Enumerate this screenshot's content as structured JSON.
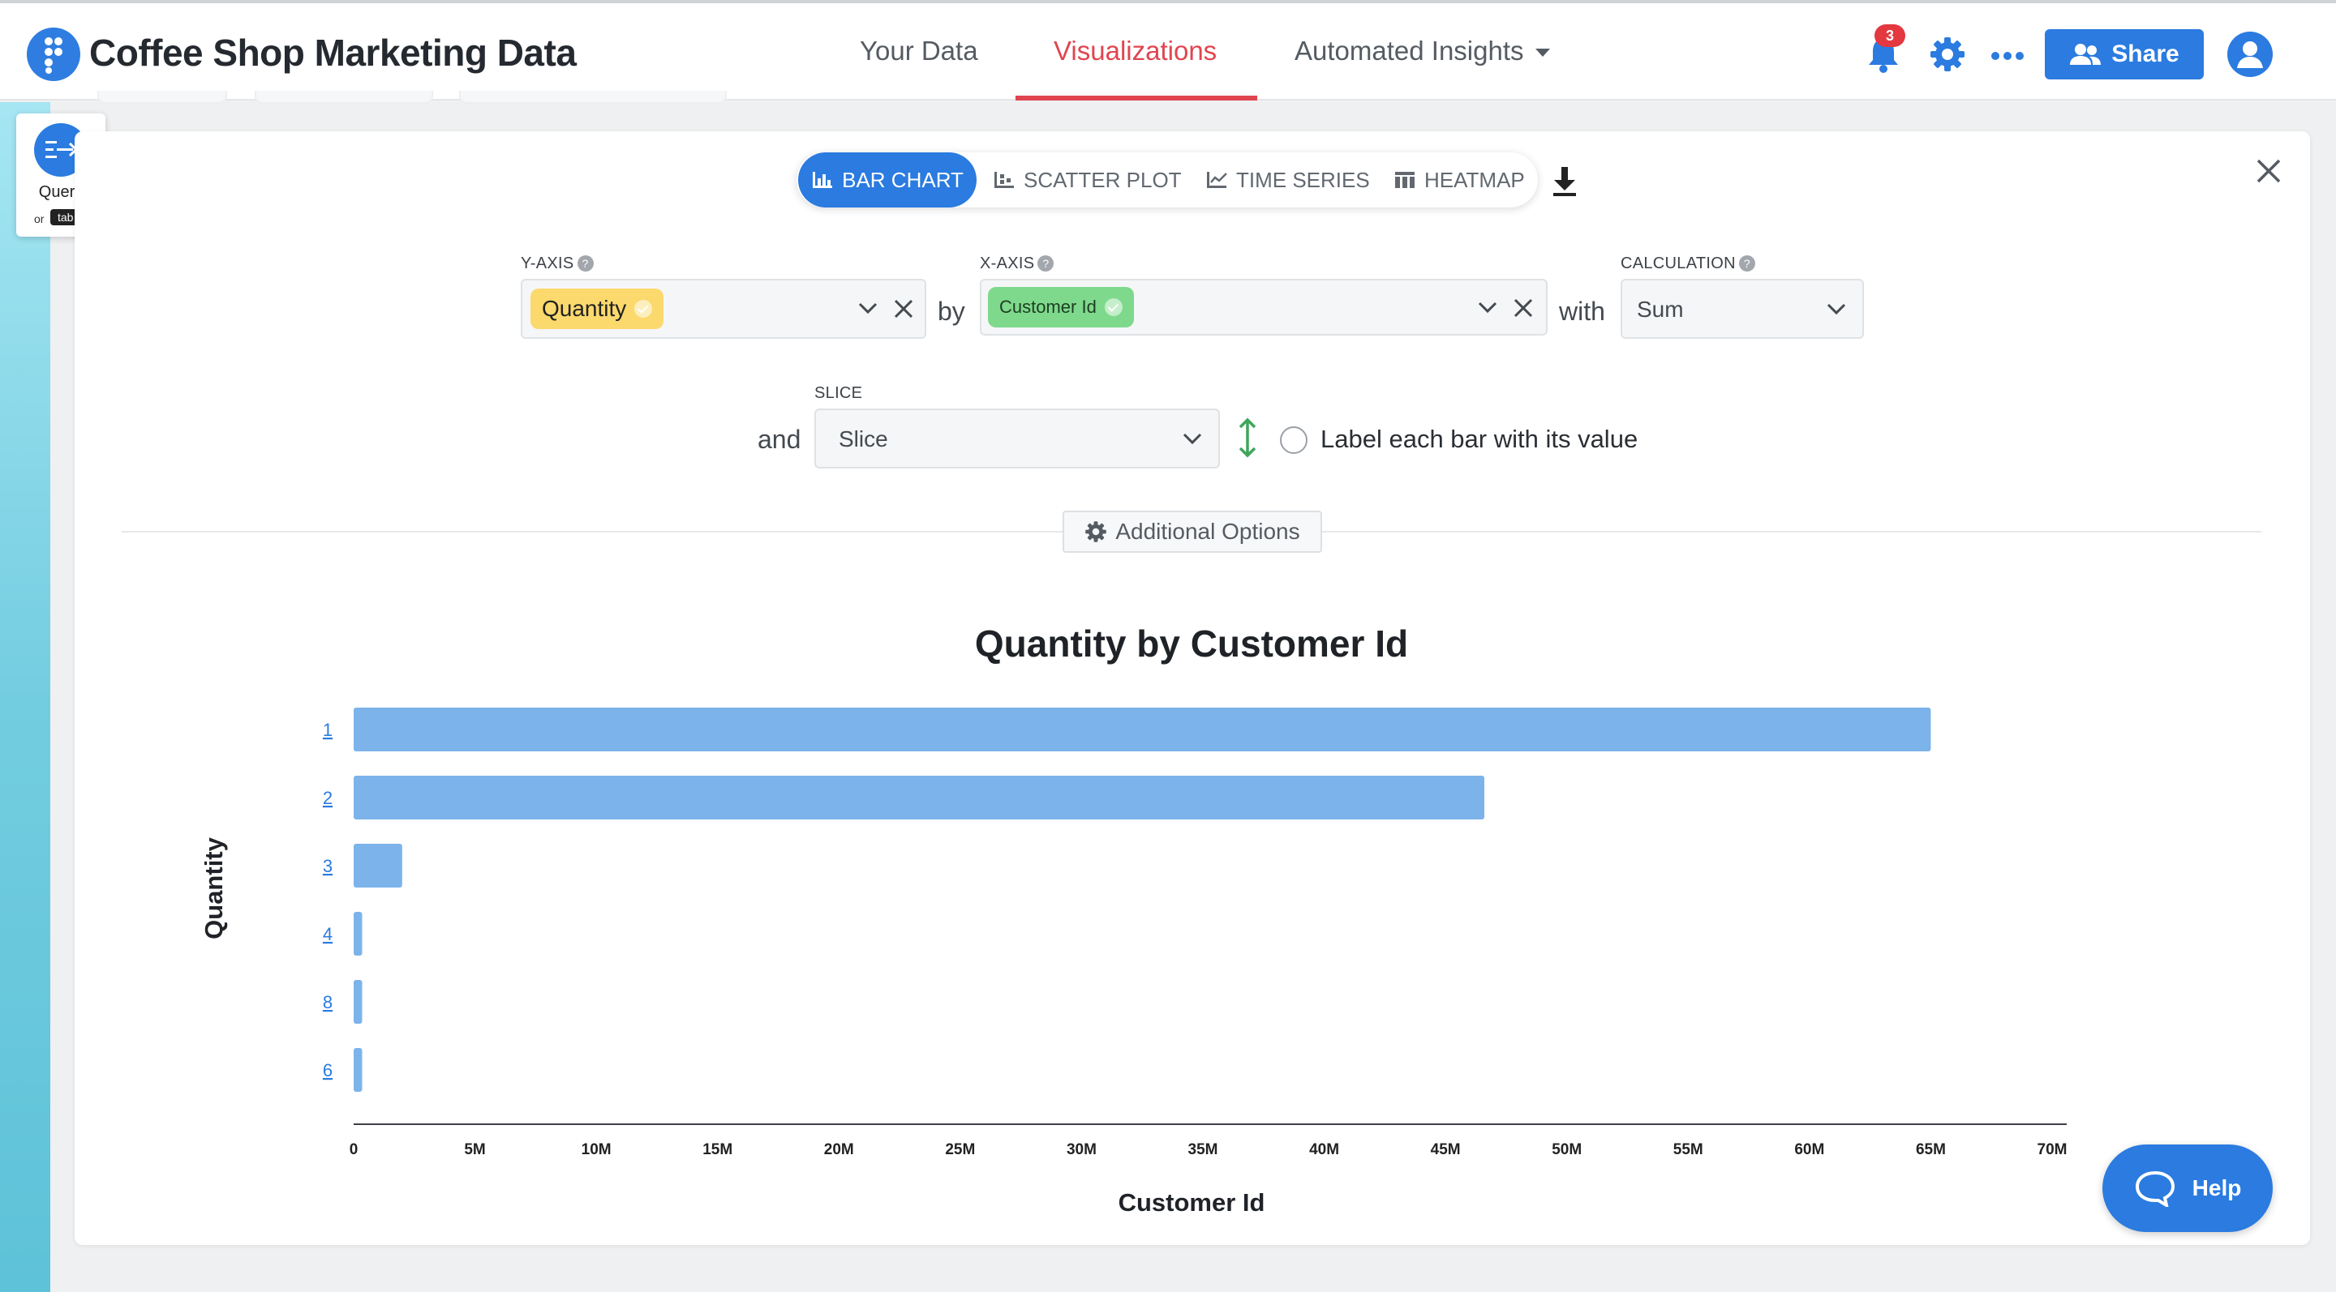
{
  "header": {
    "title": "Coffee Shop Marketing Data",
    "tabs": [
      {
        "label": "Your Data",
        "active": false
      },
      {
        "label": "Visualizations",
        "active": true
      },
      {
        "label": "Automated Insights",
        "active": false,
        "dropdown": true
      }
    ],
    "notification_count": "3",
    "share_label": "Share",
    "accent_color": "#2b7be0",
    "active_tab_color": "#e0454f"
  },
  "query_widget": {
    "label": "Query",
    "or_label": "or",
    "key_label": "tab"
  },
  "toolbar": {
    "chart_types": [
      {
        "label": "BAR CHART",
        "icon": "bar-chart-icon",
        "active": true
      },
      {
        "label": "SCATTER PLOT",
        "icon": "scatter-plot-icon",
        "active": false
      },
      {
        "label": "TIME SERIES",
        "icon": "line-chart-icon",
        "active": false
      },
      {
        "label": "HEATMAP",
        "icon": "heatmap-icon",
        "active": false
      }
    ]
  },
  "config": {
    "y_axis_label": "Y-AXIS",
    "y_axis_value": "Quantity",
    "by_label": "by",
    "x_axis_label": "X-AXIS",
    "x_axis_value": "Customer Id",
    "with_label": "with",
    "calculation_label": "CALCULATION",
    "calculation_value": "Sum",
    "and_label": "and",
    "slice_label": "SLICE",
    "slice_placeholder": "Slice",
    "label_bars_text": "Label each bar with its value",
    "additional_options_label": "Additional Options"
  },
  "chart_data": {
    "type": "bar",
    "orientation": "horizontal",
    "title": "Quantity by Customer Id",
    "xlabel": "Customer Id",
    "ylabel": "Quantity",
    "categories": [
      "1",
      "2",
      "3",
      "4",
      "8",
      "6"
    ],
    "values": [
      65000000,
      46600000,
      2000000,
      350000,
      350000,
      350000
    ],
    "xlim": [
      0,
      70000000
    ],
    "xticks": [
      "0",
      "5M",
      "10M",
      "15M",
      "20M",
      "25M",
      "30M",
      "35M",
      "40M",
      "45M",
      "50M",
      "55M",
      "60M",
      "65M",
      "70M"
    ],
    "bar_color": "#7cb3ea",
    "grid": false
  },
  "help_label": "Help"
}
